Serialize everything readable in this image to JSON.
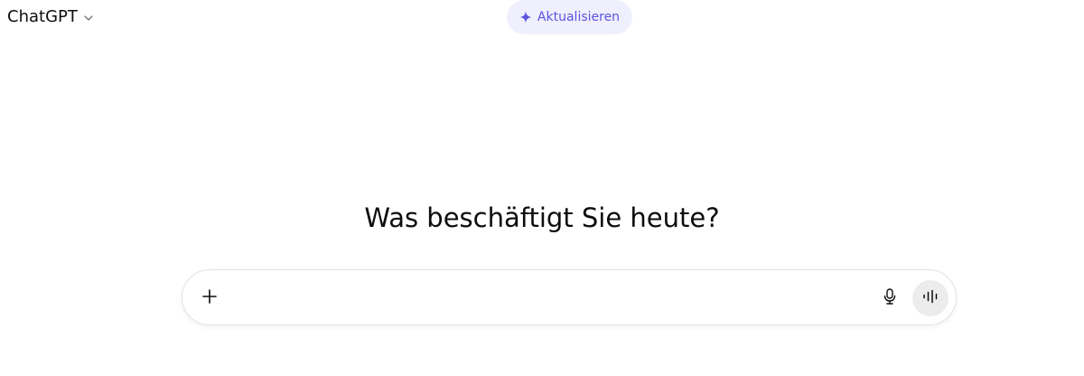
{
  "header": {
    "model_name": "ChatGPT",
    "model_icon": "chevron-down-icon",
    "upgrade_label": "Aktualisieren",
    "upgrade_icon": "sparkle-icon",
    "upgrade_color": "#5b54e0",
    "upgrade_bg": "#f0effd"
  },
  "main": {
    "heading": "Was beschäftigt Sie heute?"
  },
  "composer": {
    "input_value": "",
    "placeholder": "",
    "plus_icon": "plus-icon",
    "mic_icon": "microphone-icon",
    "voice_icon": "voice-mode-icon"
  }
}
